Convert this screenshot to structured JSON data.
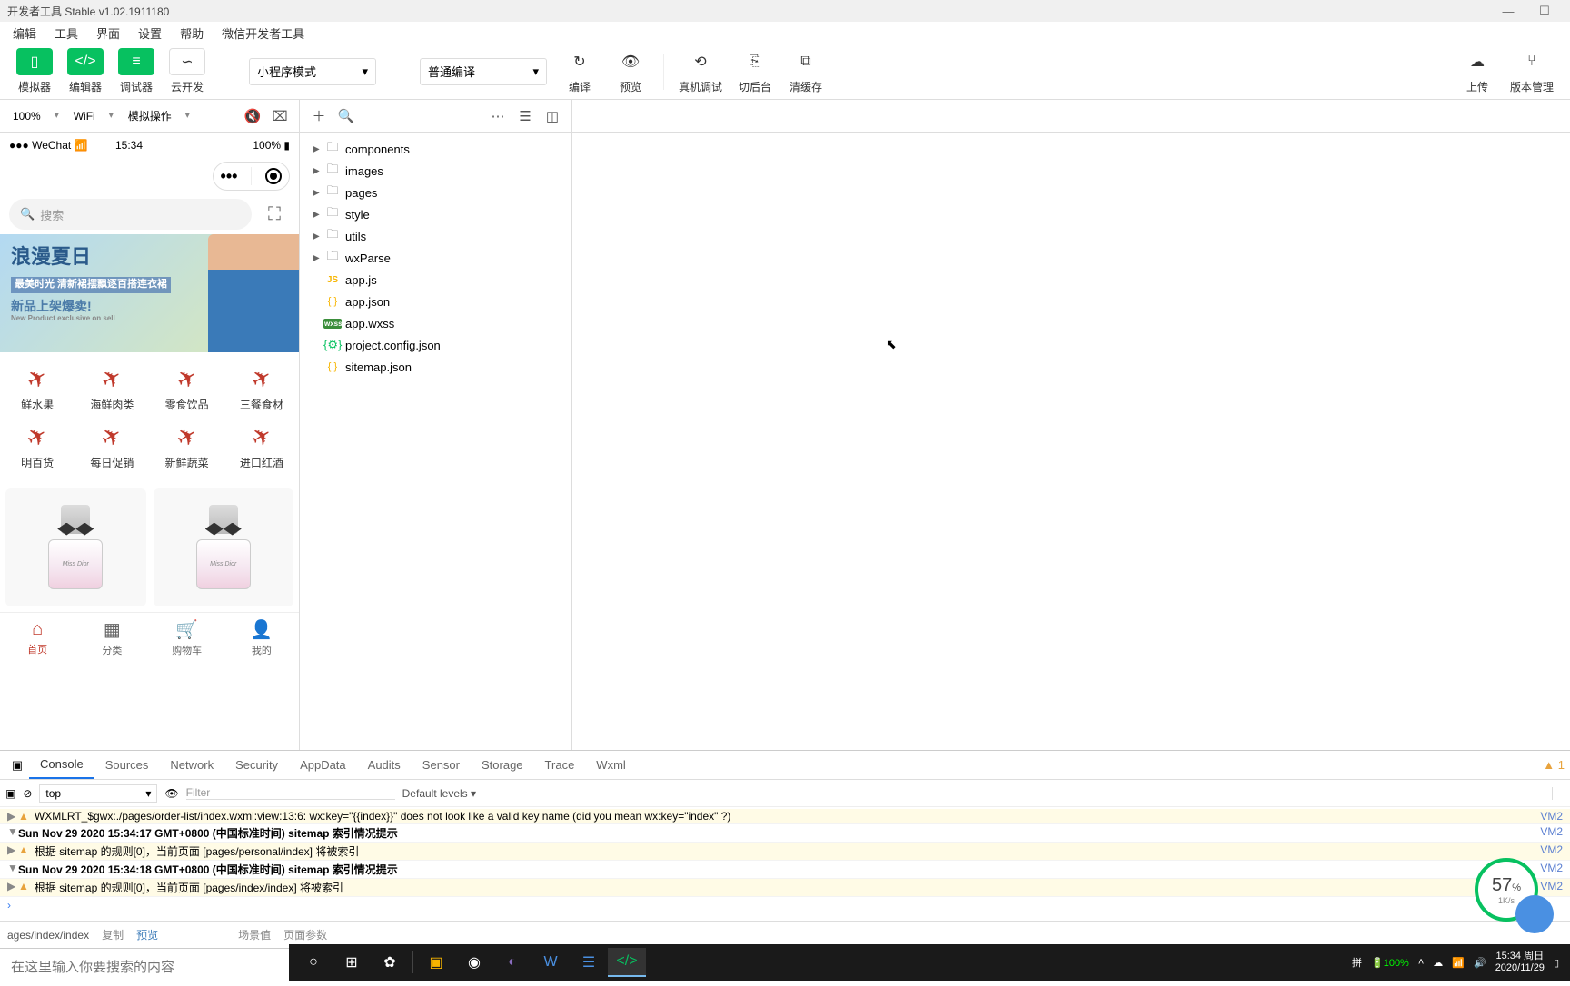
{
  "window": {
    "title": "开发者工具 Stable v1.02.1911180"
  },
  "menu": [
    "编辑",
    "工具",
    "界面",
    "设置",
    "帮助",
    "微信开发者工具"
  ],
  "toolbar": {
    "simulator": "模拟器",
    "editor": "编辑器",
    "debugger": "调试器",
    "cloud": "云开发",
    "mode": "小程序模式",
    "compileMode": "普通编译",
    "compile": "编译",
    "preview": "预览",
    "remote": "真机调试",
    "background": "切后台",
    "clear": "清缓存",
    "upload": "上传",
    "version": "版本管理"
  },
  "subbar": {
    "zoom": "100%",
    "network": "WiFi",
    "simop": "模拟操作"
  },
  "phone": {
    "carrier": "WeChat",
    "time": "15:34",
    "battery": "100%",
    "searchPlaceholder": "搜索",
    "banner": {
      "title": "浪漫夏日",
      "tag": "最美时光 清新裙摆飘逐百搭连衣裙",
      "sub": "新品上架爆卖!",
      "en": "New Product exclusive on sell"
    },
    "cats": [
      "鲜水果",
      "海鲜肉类",
      "零食饮品",
      "三餐食材",
      "明百货",
      "每日促销",
      "新鲜蔬菜",
      "进口红酒"
    ],
    "tabs": [
      {
        "label": "首页",
        "active": true
      },
      {
        "label": "分类",
        "active": false
      },
      {
        "label": "购物车",
        "active": false
      },
      {
        "label": "我的",
        "active": false
      }
    ],
    "productLabel": "Miss Dior"
  },
  "tree": [
    {
      "name": "components",
      "type": "folder"
    },
    {
      "name": "images",
      "type": "folder"
    },
    {
      "name": "pages",
      "type": "folder"
    },
    {
      "name": "style",
      "type": "folder"
    },
    {
      "name": "utils",
      "type": "folder"
    },
    {
      "name": "wxParse",
      "type": "folder"
    },
    {
      "name": "app.js",
      "type": "js"
    },
    {
      "name": "app.json",
      "type": "json"
    },
    {
      "name": "app.wxss",
      "type": "wxss"
    },
    {
      "name": "project.config.json",
      "type": "cfg"
    },
    {
      "name": "sitemap.json",
      "type": "json"
    }
  ],
  "devtools": {
    "tabs": [
      "Console",
      "Sources",
      "Network",
      "Security",
      "AppData",
      "Audits",
      "Sensor",
      "Storage",
      "Trace",
      "Wxml"
    ],
    "activeTab": "Console",
    "context": "top",
    "filter": "Filter",
    "levels": "Default levels",
    "warnCount": "1",
    "logs": [
      {
        "type": "warn",
        "arrow": "▶",
        "text": "WXMLRT_$gwx:./pages/order-list/index.wxml:view:13:6: wx:key=\"{{index}}\" does not look like a valid key name (did you mean wx:key=\"index\" ?)",
        "src": "VM2"
      },
      {
        "type": "group",
        "arrow": "▼",
        "text": "Sun Nov 29 2020 15:34:17 GMT+0800 (中国标准时间) sitemap 索引情况提示",
        "src": "VM2"
      },
      {
        "type": "warn",
        "arrow": "▶",
        "indent": true,
        "text": "根据 sitemap 的规则[0]，当前页面 [pages/personal/index] 将被索引",
        "src": "VM2"
      },
      {
        "type": "group",
        "arrow": "▼",
        "text": "Sun Nov 29 2020 15:34:18 GMT+0800 (中国标准时间) sitemap 索引情况提示",
        "src": "VM2"
      },
      {
        "type": "warn",
        "arrow": "▶",
        "indent": true,
        "text": "根据 sitemap 的规则[0]，当前页面 [pages/index/index] 将被索引",
        "src": "VM2"
      }
    ]
  },
  "status": {
    "path": "ages/index/index",
    "copy": "复制",
    "preview": "预览",
    "scene": "场景值",
    "params": "页面参数"
  },
  "search": {
    "placeholder": "在这里输入你要搜索的内容"
  },
  "taskbar": {
    "ime": "拼",
    "battery": "100%",
    "time": "15:34",
    "day": "周日",
    "date": "2020/11/29"
  },
  "perf": {
    "value": "57",
    "unit": "%",
    "rate": "1K/s"
  }
}
